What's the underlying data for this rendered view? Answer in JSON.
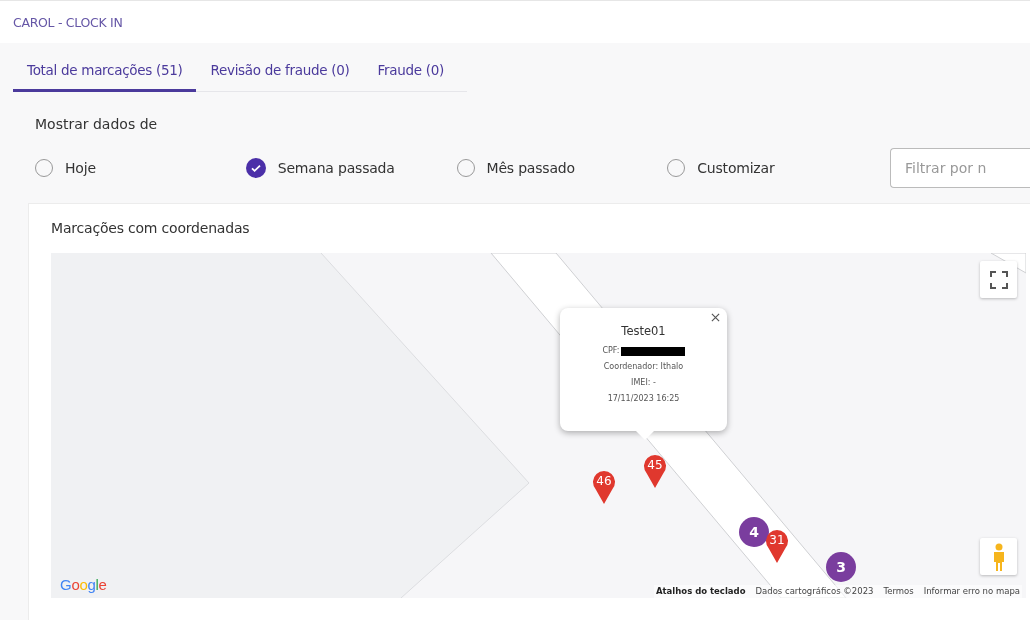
{
  "window": {
    "title": "CAROL - CLOCK IN"
  },
  "tabs": [
    {
      "label": "Total de marcações (51)",
      "selected": true
    },
    {
      "label": "Revisão de fraude (0)",
      "selected": false
    },
    {
      "label": "Fraude (0)",
      "selected": false
    }
  ],
  "period": {
    "label": "Mostrar dados de",
    "options": [
      {
        "label": "Hoje",
        "selected": false
      },
      {
        "label": "Semana passada",
        "selected": true
      },
      {
        "label": "Mês passado",
        "selected": false
      },
      {
        "label": "Customizar",
        "selected": false
      }
    ]
  },
  "filter": {
    "placeholder": "Filtrar por n"
  },
  "map_card": {
    "title": "Marcações com coordenadas",
    "markers": [
      {
        "kind": "pin",
        "label": "46",
        "color": "#e0382e"
      },
      {
        "kind": "pin",
        "label": "45",
        "color": "#e0382e"
      },
      {
        "kind": "pin",
        "label": "31",
        "color": "#e0382e"
      },
      {
        "kind": "cluster",
        "label": "4",
        "color": "#7a3d9e"
      },
      {
        "kind": "cluster",
        "label": "3",
        "color": "#7a3d9e"
      }
    ],
    "popup": {
      "title": "Teste01",
      "cpf_label": "CPF:",
      "coordinator": "Coordenador: Ithalo",
      "imei": "IMEI: -",
      "datetime": "17/11/2023 16:25"
    },
    "logo": "Google",
    "attribution": [
      "Atalhos do teclado",
      "Dados cartográficos ©2023",
      "Termos",
      "Informar erro no mapa"
    ]
  }
}
